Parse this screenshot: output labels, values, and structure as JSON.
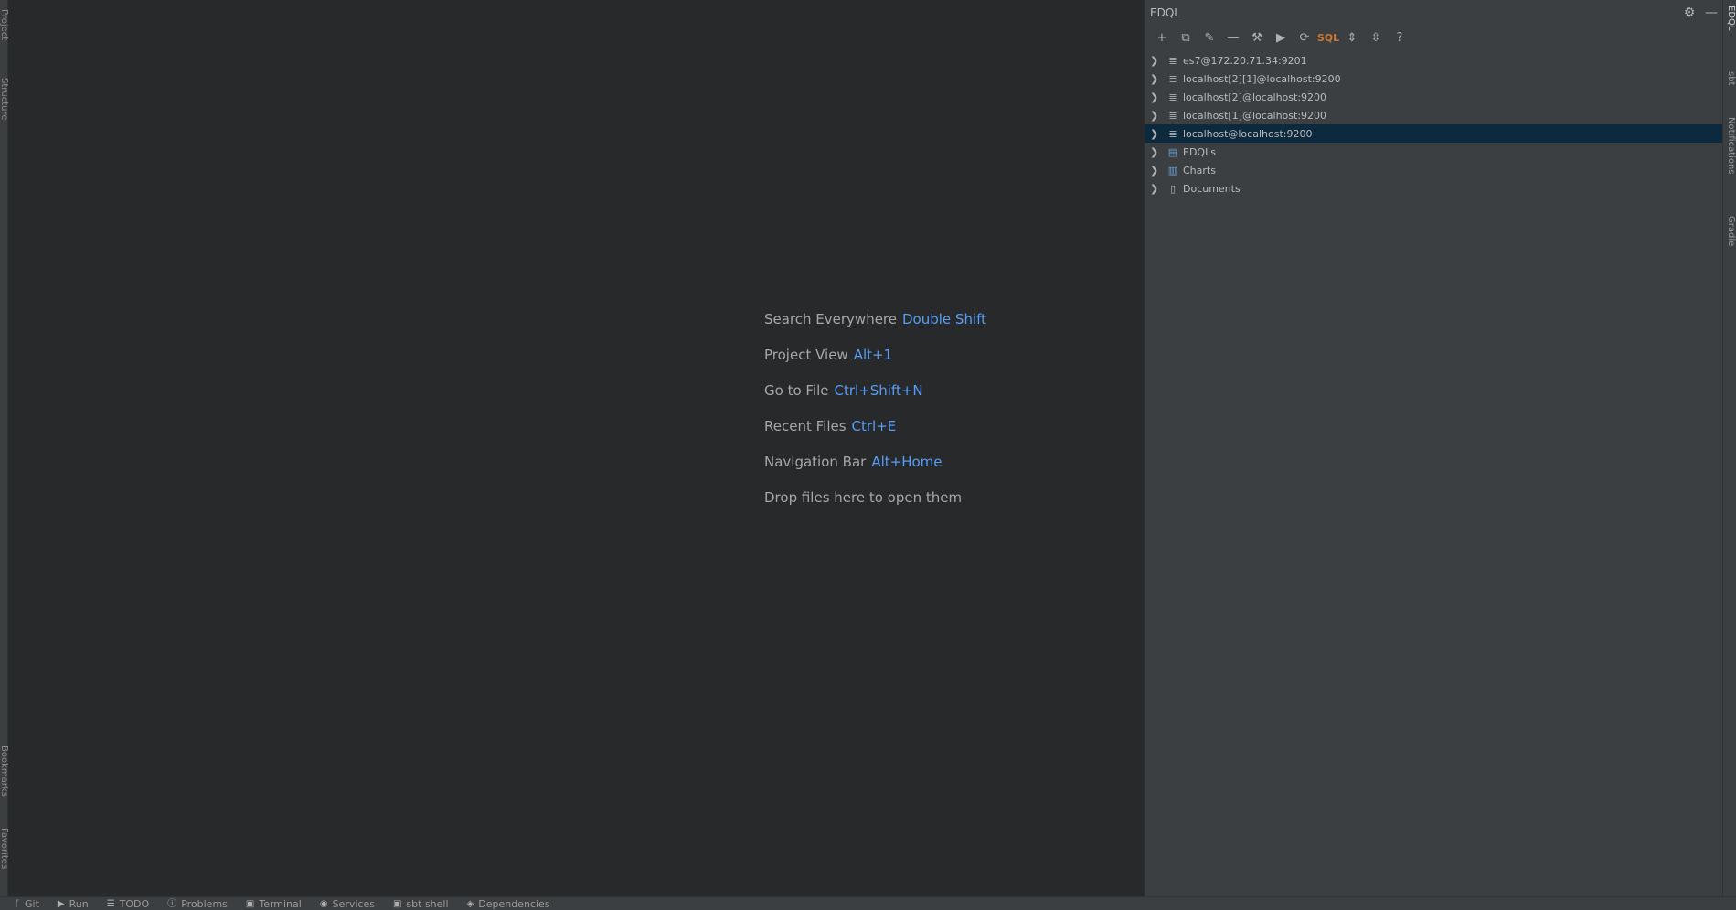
{
  "left_stripe": {
    "tabs": [
      {
        "label": "Project",
        "icon": "folder-icon"
      },
      {
        "label": "Structure",
        "icon": "structure-icon"
      },
      {
        "label": "Bookmarks",
        "icon": "bookmark-icon"
      },
      {
        "label": "Favorites",
        "icon": "star-icon"
      }
    ]
  },
  "editor": {
    "hints": [
      {
        "label": "Search Everywhere",
        "key": "Double Shift"
      },
      {
        "label": "Project View",
        "key": "Alt+1"
      },
      {
        "label": "Go to File",
        "key": "Ctrl+Shift+N"
      },
      {
        "label": "Recent Files",
        "key": "Ctrl+E"
      },
      {
        "label": "Navigation Bar",
        "key": "Alt+Home"
      }
    ],
    "drop_text": "Drop files here to open them"
  },
  "tool_window": {
    "title": "EDQL",
    "header_icons": {
      "settings": "⚙",
      "minimize": "—"
    },
    "toolbar": [
      {
        "name": "add-icon",
        "glyph": "+"
      },
      {
        "name": "copy-icon",
        "glyph": "⧉"
      },
      {
        "name": "edit-icon",
        "glyph": "✎"
      },
      {
        "name": "remove-icon",
        "glyph": "—"
      },
      {
        "name": "tools-icon",
        "glyph": "⚒"
      },
      {
        "name": "run-icon",
        "glyph": "▶"
      },
      {
        "name": "refresh-icon",
        "glyph": "⟳"
      },
      {
        "name": "sql-icon",
        "glyph": "SQL"
      },
      {
        "name": "expand-all-icon",
        "glyph": "⇕"
      },
      {
        "name": "collapse-all-icon",
        "glyph": "⇳"
      },
      {
        "name": "help-icon",
        "glyph": "?"
      }
    ],
    "tree": [
      {
        "label": "es7@172.20.71.34:9201",
        "icon": "≣",
        "selected": false
      },
      {
        "label": "localhost[2][1]@localhost:9200",
        "icon": "≣",
        "selected": false
      },
      {
        "label": "localhost[2]@localhost:9200",
        "icon": "≣",
        "selected": false
      },
      {
        "label": "localhost[1]@localhost:9200",
        "icon": "≣",
        "selected": false
      },
      {
        "label": "localhost@localhost:9200",
        "icon": "≣",
        "selected": true
      },
      {
        "label": "EDQLs",
        "icon": "▤",
        "selected": false
      },
      {
        "label": "Charts",
        "icon": "▥",
        "selected": false
      },
      {
        "label": "Documents",
        "icon": "▯",
        "selected": false
      }
    ]
  },
  "right_stripe": {
    "tabs": [
      "EDQL",
      "sbt",
      "Notifications",
      "Gradle"
    ]
  },
  "bottom_bar": {
    "items": [
      {
        "label": "Git",
        "icon": "ᚴ"
      },
      {
        "label": "Run",
        "icon": "▶"
      },
      {
        "label": "TODO",
        "icon": "☰"
      },
      {
        "label": "Problems",
        "icon": "ⓘ"
      },
      {
        "label": "Terminal",
        "icon": "▣"
      },
      {
        "label": "Services",
        "icon": "◉"
      },
      {
        "label": "sbt shell",
        "icon": "▣"
      },
      {
        "label": "Dependencies",
        "icon": "◈"
      }
    ]
  }
}
